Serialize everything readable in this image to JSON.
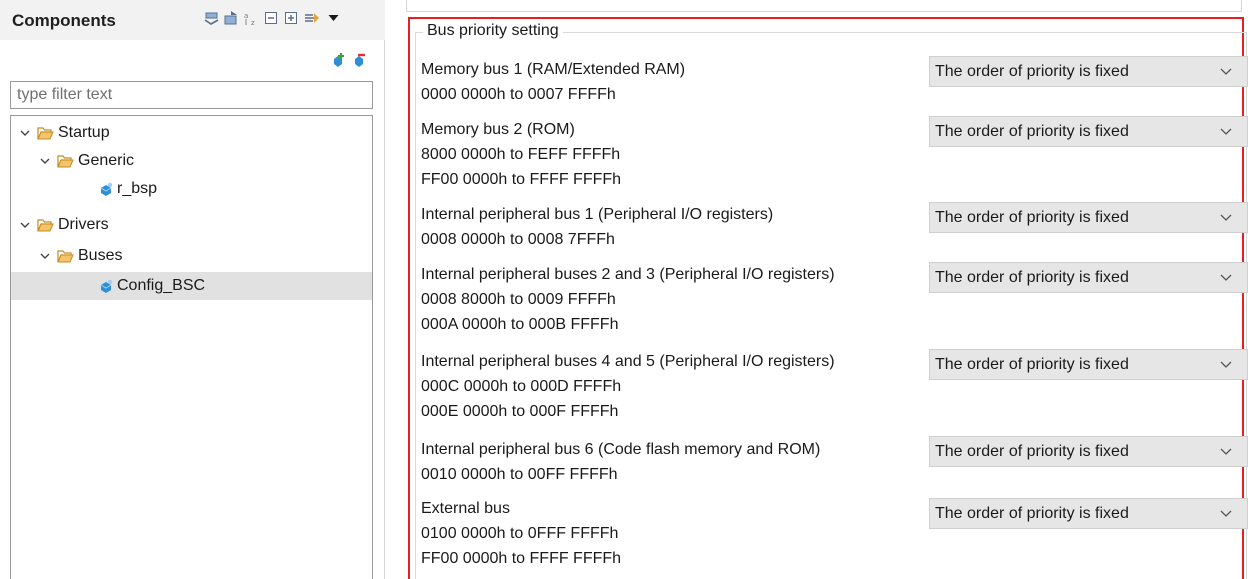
{
  "components_view": {
    "title": "Components",
    "toolbar_icons": [
      "expand-all-icon",
      "collapse-tree-icon",
      "sort-alphabetically-icon",
      "collapse-all-icon",
      "expand-node-icon",
      "link-with-editor-icon",
      "view-menu-icon"
    ],
    "mini_toolbar_icons": [
      "add-component-icon",
      "remove-component-icon"
    ],
    "filter": {
      "placeholder": "type filter text",
      "value": ""
    },
    "tree": [
      {
        "label": "Startup",
        "type": "folder",
        "level": 0,
        "expanded": true
      },
      {
        "label": "Generic",
        "type": "folder",
        "level": 1,
        "expanded": true
      },
      {
        "label": "r_bsp",
        "type": "component",
        "level": 2
      },
      {
        "label": "Drivers",
        "type": "folder",
        "level": 0,
        "expanded": true
      },
      {
        "label": "Buses",
        "type": "folder",
        "level": 1,
        "expanded": true
      },
      {
        "label": "Config_BSC",
        "type": "component",
        "level": 2,
        "selected": true
      }
    ]
  },
  "settings": {
    "group_title": "Bus priority setting",
    "items": [
      {
        "label": "Memory bus 1 (RAM/Extended RAM)",
        "ranges": [
          "0000 0000h to 0007 FFFFh"
        ],
        "value": "The order of priority is fixed"
      },
      {
        "label": "Memory bus 2 (ROM)",
        "ranges": [
          "8000 0000h to FEFF FFFFh",
          "FF00 0000h to FFFF FFFFh"
        ],
        "value": "The order of priority is fixed"
      },
      {
        "label": "Internal peripheral bus 1 (Peripheral I/O registers)",
        "ranges": [
          "0008 0000h to 0008 7FFFh"
        ],
        "value": "The order of priority is fixed"
      },
      {
        "label": "Internal peripheral buses 2 and 3 (Peripheral I/O registers)",
        "ranges": [
          "0008 8000h to 0009 FFFFh",
          "000A 0000h to 000B FFFFh"
        ],
        "value": "The order of priority is fixed"
      },
      {
        "label": "Internal peripheral buses 4 and 5 (Peripheral I/O registers)",
        "ranges": [
          "000C 0000h to 000D FFFFh",
          "000E 0000h to 000F FFFFh"
        ],
        "value": "The order of priority is fixed"
      },
      {
        "label": "Internal peripheral bus 6 (Code flash memory and ROM)",
        "ranges": [
          "0010 0000h to 00FF FFFFh"
        ],
        "value": "The order of priority is fixed"
      },
      {
        "label": "External bus",
        "ranges": [
          "0100 0000h to 0FFF FFFFh",
          "FF00 0000h to FFFF FFFFh"
        ],
        "value": "The order of priority is fixed"
      }
    ]
  },
  "colors": {
    "highlight_border": "#e81e25",
    "selection": "#e1e1e1",
    "dropdown_bg": "#e6e6e6",
    "folder": "#e8a33a",
    "component": "#2e8fd6"
  }
}
